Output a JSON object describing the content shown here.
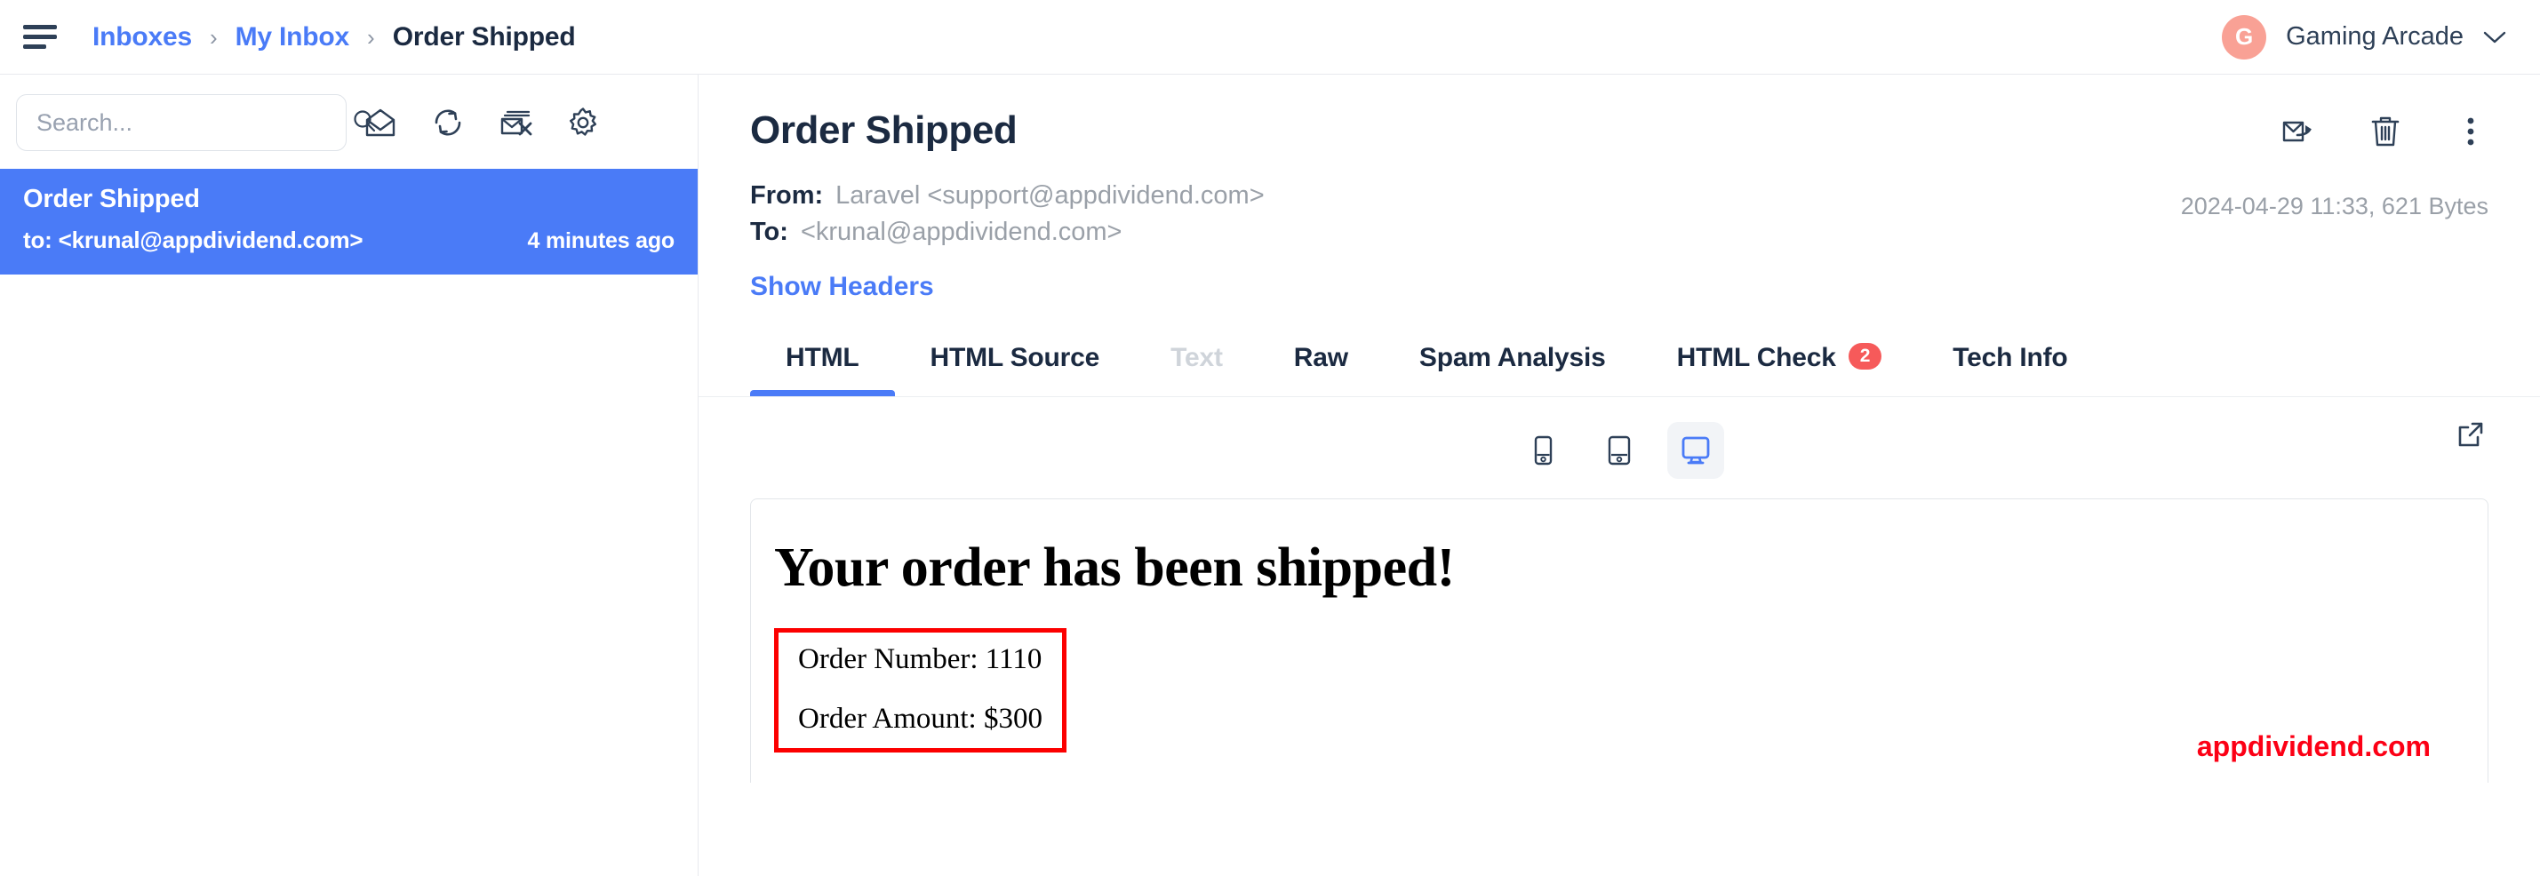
{
  "topbar": {
    "menu_icon": "hamburger-icon",
    "breadcrumb": {
      "items": [
        {
          "label": "Inboxes",
          "type": "link"
        },
        {
          "label": "My Inbox",
          "type": "link"
        },
        {
          "label": "Order Shipped",
          "type": "current"
        }
      ],
      "separator": "›"
    },
    "user": {
      "avatar_initial": "G",
      "avatar_color": "#f9a195",
      "name": "Gaming Arcade",
      "chevron_icon": "chevron-down-icon"
    }
  },
  "sidebar": {
    "search": {
      "placeholder": "Search...",
      "value": "",
      "icon": "search-icon"
    },
    "toolbar_icons": [
      {
        "name": "mark-all-read-icon",
        "title": "Mark all read"
      },
      {
        "name": "refresh-icon",
        "title": "Refresh"
      },
      {
        "name": "delete-all-icon",
        "title": "Delete all"
      },
      {
        "name": "settings-gear-icon",
        "title": "Settings"
      }
    ],
    "messages": [
      {
        "subject": "Order Shipped",
        "to": "to: <krunal@appdividend.com>",
        "time": "4 minutes ago",
        "selected": true
      }
    ]
  },
  "message": {
    "title": "Order Shipped",
    "from_label": "From:",
    "from_value": "Laravel <support@appdividend.com>",
    "to_label": "To:",
    "to_value": "<krunal@appdividend.com>",
    "date_size": "2024-04-29 11:33, 621 Bytes",
    "show_headers": "Show Headers",
    "actions": [
      {
        "name": "forward-email-icon",
        "title": "Forward"
      },
      {
        "name": "trash-icon",
        "title": "Delete"
      },
      {
        "name": "more-vertical-icon",
        "title": "More"
      }
    ],
    "tabs": [
      {
        "label": "HTML",
        "active": true,
        "disabled": false
      },
      {
        "label": "HTML Source",
        "active": false,
        "disabled": false
      },
      {
        "label": "Text",
        "active": false,
        "disabled": true
      },
      {
        "label": "Raw",
        "active": false,
        "disabled": false
      },
      {
        "label": "Spam Analysis",
        "active": false,
        "disabled": false
      },
      {
        "label": "HTML Check",
        "active": false,
        "disabled": false,
        "badge": "2"
      },
      {
        "label": "Tech Info",
        "active": false,
        "disabled": false
      }
    ],
    "preview": {
      "devices": [
        {
          "name": "phone-icon",
          "label": "Phone",
          "active": false
        },
        {
          "name": "tablet-icon",
          "label": "Tablet",
          "active": false
        },
        {
          "name": "desktop-icon",
          "label": "Desktop",
          "active": true
        }
      ],
      "popout_icon": "external-link-icon"
    },
    "body": {
      "heading": "Your order has been shipped!",
      "order_number": "Order Number: 1110",
      "order_amount": "Order Amount: $300",
      "box_border_color": "#fc0000"
    }
  },
  "watermark": {
    "text": "appdividend.com",
    "color": "#fc0015"
  }
}
